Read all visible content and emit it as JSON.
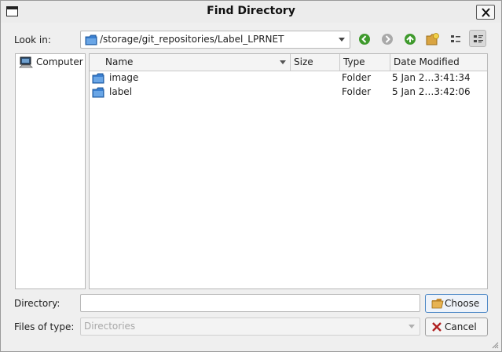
{
  "window": {
    "title": "Find Directory"
  },
  "toolbar": {
    "look_in_label": "Look in:",
    "path": "/storage/git_repositories/Label_LPRNET",
    "icons": [
      "back-icon",
      "forward-icon",
      "parent-directory-icon",
      "new-folder-icon",
      "list-view-icon",
      "detail-view-icon"
    ]
  },
  "sidebar": {
    "items": [
      {
        "label": "Computer",
        "icon": "computer-icon"
      }
    ]
  },
  "filelist": {
    "columns": [
      "Name",
      "Size",
      "Type",
      "Date Modified"
    ],
    "rows": [
      {
        "name": "image",
        "size": "",
        "type": "Folder",
        "modified": "5 Jan 2…3:41:34"
      },
      {
        "name": "label",
        "size": "",
        "type": "Folder",
        "modified": "5 Jan 2…3:42:06"
      }
    ]
  },
  "footer": {
    "directory_label": "Directory:",
    "directory_value": "",
    "files_of_type_label": "Files of type:",
    "files_of_type_value": "Directories",
    "choose_label": "Choose",
    "cancel_label": "Cancel"
  },
  "colors": {
    "folder": "#3a7fd0",
    "nav_green": "#3f9a2d",
    "default_button_border": "#4a86c5"
  }
}
